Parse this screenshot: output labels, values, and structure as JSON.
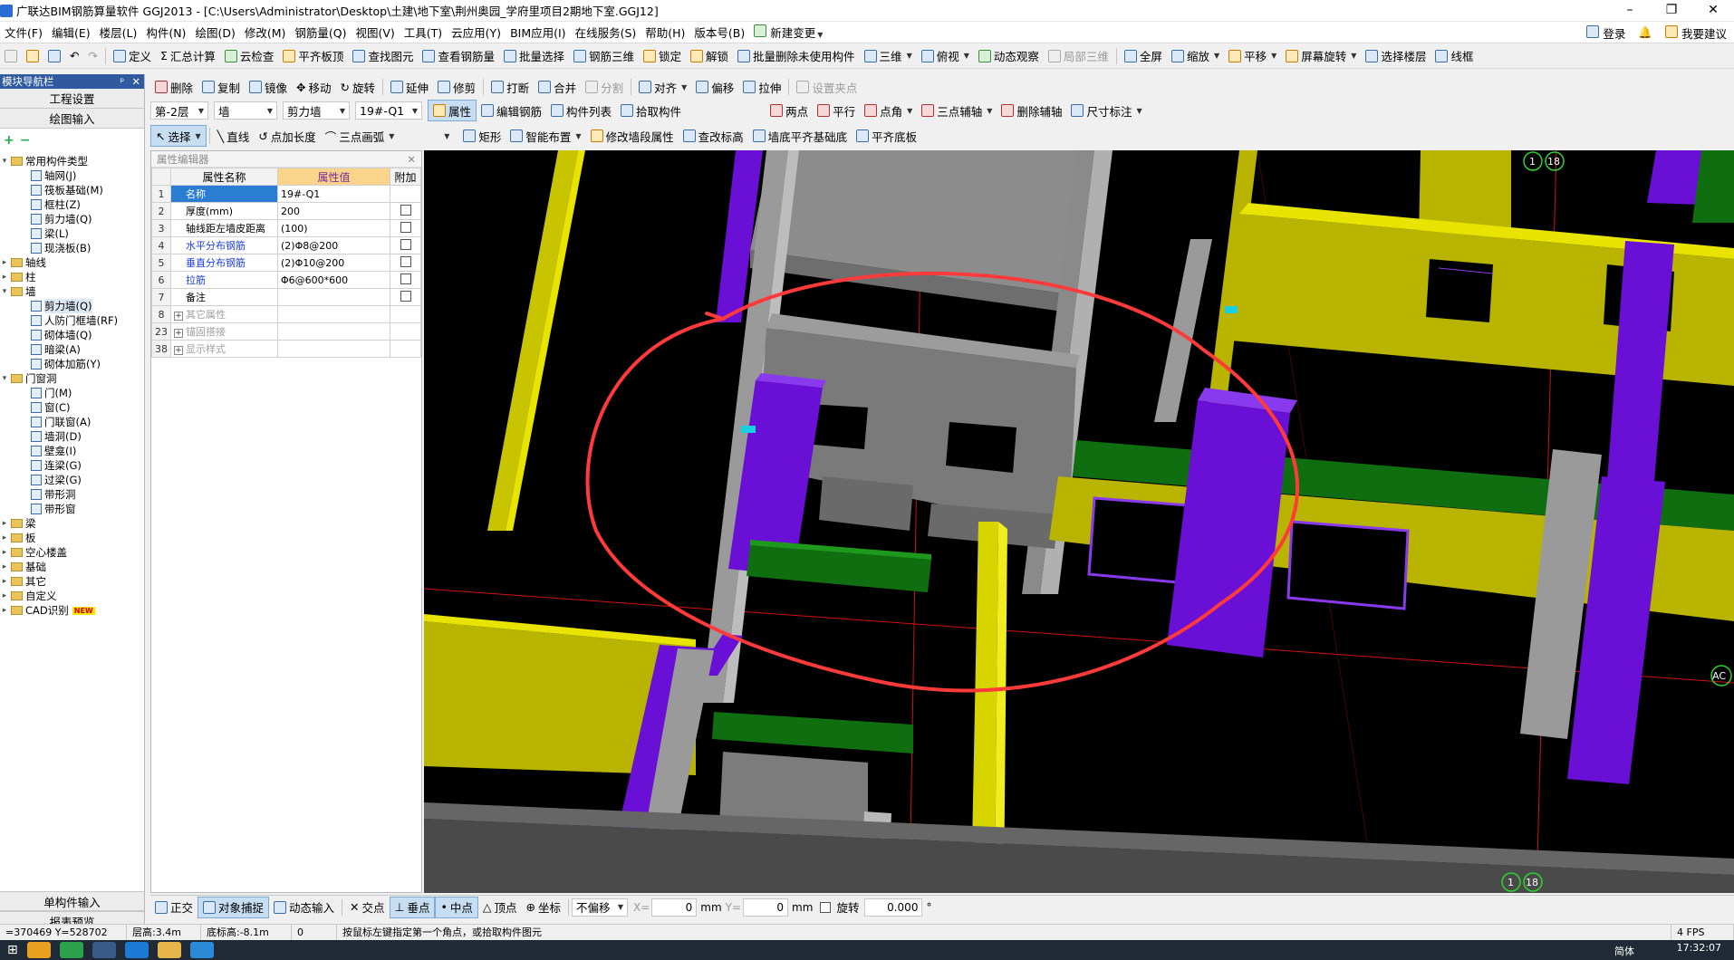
{
  "window": {
    "title": "广联达BIM钢筋算量软件 GGJ2013 - [C:\\Users\\Administrator\\Desktop\\土建\\地下室\\荆州奥园_学府里项目2期地下室.GGJ12]",
    "minimize": "–",
    "restore": "❐",
    "close": "✕"
  },
  "menu": {
    "items": [
      "文件(F)",
      "编辑(E)",
      "楼层(L)",
      "构件(N)",
      "绘图(D)",
      "修改(M)",
      "钢筋量(Q)",
      "视图(V)",
      "工具(T)",
      "云应用(Y)",
      "BIM应用(I)",
      "在线服务(S)",
      "帮助(H)",
      "版本号(B)",
      "新建变更"
    ],
    "login": "登录",
    "feedback": "我要建议"
  },
  "toolbar1": [
    "定义",
    "汇总计算",
    "云检查",
    "平齐板顶",
    "查找图元",
    "查看钢筋量",
    "批量选择",
    "钢筋三维",
    "锁定",
    "解锁",
    "批量删除未使用构件",
    "三维",
    "俯视",
    "动态观察",
    "局部三维",
    "全屏",
    "缩放",
    "平移",
    "屏幕旋转",
    "选择楼层",
    "线框"
  ],
  "toolbar2": [
    "删除",
    "复制",
    "镜像",
    "移动",
    "旋转",
    "延伸",
    "修剪",
    "打断",
    "合并",
    "分割",
    "对齐",
    "偏移",
    "拉伸",
    "设置夹点"
  ],
  "toolbar3": {
    "floor": "第-2层",
    "category": "墙",
    "type": "剪力墙",
    "component": "19#-Q1",
    "property": "属性",
    "edit_rebar": "编辑钢筋",
    "component_list": "构件列表",
    "pick_component": "拾取构件",
    "two_points": "两点",
    "parallel": "平行",
    "point_angle": "点角",
    "three_point_aux": "三点辅轴",
    "delete_aux": "删除辅轴",
    "dimension": "尺寸标注"
  },
  "toolbar4": [
    "选择",
    "直线",
    "点加长度",
    "三点画弧",
    "矩形",
    "智能布置",
    "修改墙段属性",
    "查改标高",
    "墙底平齐基础底",
    "平齐底板"
  ],
  "nav": {
    "header": "模块导航栏",
    "pin": "ᵖ",
    "close": "✕",
    "project_settings": "工程设置",
    "drawing_input": "绘图输入",
    "add_icon": "+",
    "collapse_icon": "−",
    "tree": [
      {
        "label": "常用构件类型",
        "level": 0,
        "kind": "folder",
        "expanded": true
      },
      {
        "label": "轴网(J)",
        "level": 1,
        "kind": "leaf"
      },
      {
        "label": "筏板基础(M)",
        "level": 1,
        "kind": "leaf"
      },
      {
        "label": "框柱(Z)",
        "level": 1,
        "kind": "leaf"
      },
      {
        "label": "剪力墙(Q)",
        "level": 1,
        "kind": "leaf"
      },
      {
        "label": "梁(L)",
        "level": 1,
        "kind": "leaf"
      },
      {
        "label": "现浇板(B)",
        "level": 1,
        "kind": "leaf"
      },
      {
        "label": "轴线",
        "level": 0,
        "kind": "folder",
        "expanded": false
      },
      {
        "label": "柱",
        "level": 0,
        "kind": "folder",
        "expanded": false
      },
      {
        "label": "墙",
        "level": 0,
        "kind": "folder",
        "expanded": true
      },
      {
        "label": "剪力墙(Q)",
        "level": 1,
        "kind": "leaf",
        "selected": true
      },
      {
        "label": "人防门框墙(RF)",
        "level": 1,
        "kind": "leaf"
      },
      {
        "label": "砌体墙(Q)",
        "level": 1,
        "kind": "leaf"
      },
      {
        "label": "暗梁(A)",
        "level": 1,
        "kind": "leaf"
      },
      {
        "label": "砌体加筋(Y)",
        "level": 1,
        "kind": "leaf"
      },
      {
        "label": "门窗洞",
        "level": 0,
        "kind": "folder",
        "expanded": true
      },
      {
        "label": "门(M)",
        "level": 1,
        "kind": "leaf"
      },
      {
        "label": "窗(C)",
        "level": 1,
        "kind": "leaf"
      },
      {
        "label": "门联窗(A)",
        "level": 1,
        "kind": "leaf"
      },
      {
        "label": "墙洞(D)",
        "level": 1,
        "kind": "leaf"
      },
      {
        "label": "壁龛(I)",
        "level": 1,
        "kind": "leaf"
      },
      {
        "label": "连梁(G)",
        "level": 1,
        "kind": "leaf"
      },
      {
        "label": "过梁(G)",
        "level": 1,
        "kind": "leaf"
      },
      {
        "label": "带形洞",
        "level": 1,
        "kind": "leaf"
      },
      {
        "label": "带形窗",
        "level": 1,
        "kind": "leaf"
      },
      {
        "label": "梁",
        "level": 0,
        "kind": "folder",
        "expanded": false
      },
      {
        "label": "板",
        "level": 0,
        "kind": "folder",
        "expanded": false
      },
      {
        "label": "空心楼盖",
        "level": 0,
        "kind": "folder",
        "expanded": false
      },
      {
        "label": "基础",
        "level": 0,
        "kind": "folder",
        "expanded": false
      },
      {
        "label": "其它",
        "level": 0,
        "kind": "folder",
        "expanded": false
      },
      {
        "label": "自定义",
        "level": 0,
        "kind": "folder",
        "expanded": false
      },
      {
        "label": "CAD识别",
        "level": 0,
        "kind": "folder",
        "expanded": false,
        "badge": "NEW"
      }
    ],
    "single_input": "单构件输入",
    "report_preview": "报表预览"
  },
  "property_editor": {
    "title": "属性编辑器",
    "close": "✕",
    "headers": [
      "属性名称",
      "属性值",
      "附加"
    ],
    "rows": [
      {
        "no": "1",
        "name": "名称",
        "value": "19#-Q1",
        "style": "selected",
        "check": false
      },
      {
        "no": "2",
        "name": "厚度(mm)",
        "value": "200",
        "style": "normal",
        "check": true
      },
      {
        "no": "3",
        "name": "轴线距左墙皮距离",
        "value": "(100)",
        "style": "normal",
        "check": true
      },
      {
        "no": "4",
        "name": "水平分布钢筋",
        "value": "(2)Φ8@200",
        "style": "blue",
        "check": true
      },
      {
        "no": "5",
        "name": "垂直分布钢筋",
        "value": "(2)Φ10@200",
        "style": "blue",
        "check": true
      },
      {
        "no": "6",
        "name": "拉筋",
        "value": "Φ6@600*600",
        "style": "blue",
        "check": true
      },
      {
        "no": "7",
        "name": "备注",
        "value": "",
        "style": "normal",
        "check": true
      },
      {
        "no": "8",
        "name": "其它属性",
        "value": "",
        "style": "group",
        "check": false
      },
      {
        "no": "23",
        "name": "锚固搭接",
        "value": "",
        "style": "group",
        "check": false
      },
      {
        "no": "38",
        "name": "显示样式",
        "value": "",
        "style": "group",
        "check": false
      }
    ]
  },
  "viewport": {
    "axis_top": "1",
    "axis_top_b": "18",
    "axis_bottom": "1",
    "axis_bottom_b": "18",
    "axis_right": "AC",
    "colors": {
      "background": "#000000",
      "wall_yellow": "#c8c400",
      "column_purple": "#6a0fd6",
      "beam_green": "#0f6e0f",
      "slab_gray": "#8c8c8c",
      "annotation_red": "#ff3a3a",
      "grid_red": "#d01010"
    }
  },
  "snapbar": {
    "ortho": "正交",
    "object_snap": "对象捕捉",
    "dynamic_input": "动态输入",
    "intersection": "交点",
    "perpendicular": "垂点",
    "midpoint": "中点",
    "vertex": "顶点",
    "coordinate": "坐标",
    "offset": "不偏移",
    "x_label": "X=",
    "x_value": "0",
    "y_label": "Y=",
    "y_value": "0",
    "unit": "mm",
    "rotate": "旋转",
    "rotate_value": "0.000",
    "degree": "°"
  },
  "status": {
    "coords": "=370469 Y=528702",
    "floor_height": "层高:3.4m",
    "base_elevation": "底标高:-8.1m",
    "count": "0",
    "hint": "按鼠标左键指定第一个角点，或拾取构件图元",
    "fps": "4 FPS"
  },
  "taskbar": {
    "time": "17:32:07",
    "lang": "简体"
  }
}
